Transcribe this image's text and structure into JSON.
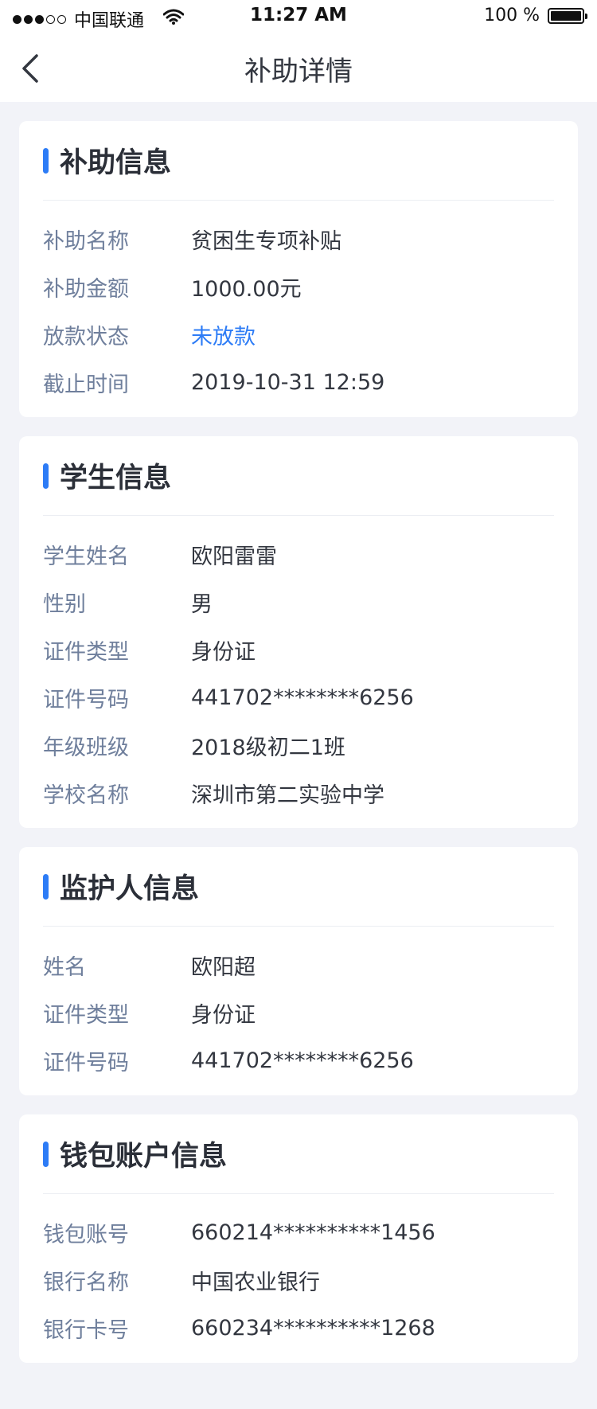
{
  "status_bar": {
    "carrier": "中国联通",
    "time": "11:27 AM",
    "battery_text": "100 %",
    "signal_bars_filled": 3,
    "signal_bars_total": 5
  },
  "nav": {
    "title": "补助详情"
  },
  "colors": {
    "accent": "#2d7cf6",
    "label": "#6f7f9c",
    "value": "#333740",
    "page_bg": "#f2f3f8"
  },
  "subsidy": {
    "title": "补助信息",
    "rows": [
      {
        "label": "补助名称",
        "value": "贫困生专项补贴"
      },
      {
        "label": "补助金额",
        "value": "1000.00元"
      },
      {
        "label": "放款状态",
        "value": "未放款"
      },
      {
        "label": "截止时间",
        "value": "2019-10-31 12:59"
      }
    ]
  },
  "student": {
    "title": "学生信息",
    "rows": [
      {
        "label": "学生姓名",
        "value": "欧阳雷雷"
      },
      {
        "label": "性别",
        "value": "男"
      },
      {
        "label": "证件类型",
        "value": "身份证"
      },
      {
        "label": "证件号码",
        "value": "441702********6256"
      },
      {
        "label": "年级班级",
        "value": "2018级初二1班"
      },
      {
        "label": "学校名称",
        "value": "深圳市第二实验中学"
      }
    ]
  },
  "guardian": {
    "title": "监护人信息",
    "rows": [
      {
        "label": "姓名",
        "value": "欧阳超"
      },
      {
        "label": "证件类型",
        "value": "身份证"
      },
      {
        "label": "证件号码",
        "value": "441702********6256"
      }
    ]
  },
  "wallet": {
    "title": "钱包账户信息",
    "rows": [
      {
        "label": "钱包账号",
        "value": "660214**********1456"
      },
      {
        "label": "银行名称",
        "value": "中国农业银行"
      },
      {
        "label": "银行卡号",
        "value": "660234**********1268"
      }
    ]
  }
}
